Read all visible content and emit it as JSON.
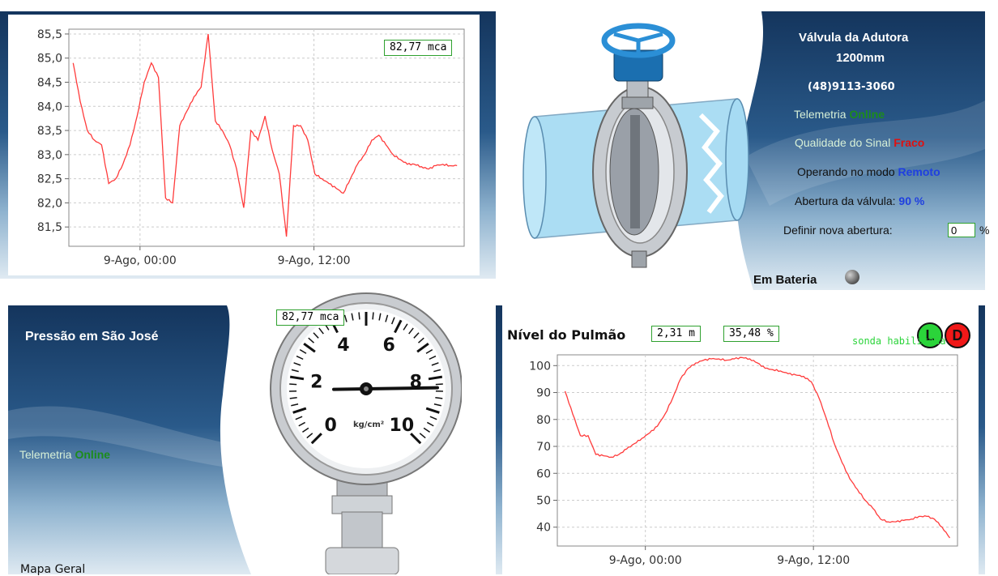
{
  "pressure_chart": {
    "value_display": "82,77 mca",
    "chart_data": {
      "type": "line",
      "y_ticks": [
        "85,5",
        "85,0",
        "84,5",
        "84,0",
        "83,5",
        "83,0",
        "82,5",
        "82,0",
        "81,5"
      ],
      "x_ticks": [
        "9-Ago, 00:00",
        "9-Ago, 12:00"
      ],
      "ylim": [
        81.1,
        85.6
      ],
      "grid": true,
      "series": [
        {
          "color": "#ff3b3b",
          "x": [
            0,
            0.5,
            1,
            1.5,
            2,
            2.5,
            3,
            3.5,
            4,
            4.5,
            5,
            5.5,
            6,
            6.5,
            7,
            7.5,
            8,
            8.5,
            9,
            9.5,
            10,
            10.5,
            11,
            11.5,
            12,
            12.5,
            13,
            13.5,
            14,
            14.5,
            15,
            15.5,
            16,
            16.5,
            17,
            17.5,
            18,
            18.5,
            19,
            19.5,
            20,
            20.5,
            21,
            21.5,
            22,
            22.5,
            23,
            23.5,
            24,
            24.5,
            25,
            25.5,
            26,
            26.5,
            27,
            27.5,
            28,
            28.5,
            29,
            29.5,
            30,
            30.5,
            31,
            31.5,
            32,
            32.5,
            33,
            33.5,
            34,
            34.5,
            35,
            35.5,
            36,
            36.5,
            37,
            37.5,
            38,
            38.5,
            39,
            39.5,
            40,
            40.5,
            41,
            41.5,
            42,
            42.5,
            43
          ],
          "y": [
            84.9,
            84.1,
            83.5,
            83.3,
            83.2,
            82.4,
            82.5,
            82.8,
            83.2,
            83.8,
            84.5,
            84.9,
            84.6,
            82.1,
            82.0,
            83.6,
            83.9,
            84.2,
            84.4,
            85.5,
            83.7,
            83.5,
            83.2,
            82.7,
            81.9,
            83.5,
            83.3,
            83.8,
            83.1,
            82.6,
            81.3,
            83.6,
            83.6,
            83.3,
            82.6,
            82.5,
            82.4,
            82.3,
            82.2,
            82.5,
            82.8,
            83.0,
            83.3,
            83.4,
            83.2,
            83.0,
            82.9,
            82.8,
            82.8,
            82.75,
            82.7,
            82.77,
            82.8,
            82.77,
            82.77,
            82.77,
            82.77,
            82.77,
            82.77,
            82.77,
            82.77,
            82.77,
            82.77,
            82.77,
            82.77,
            82.77,
            82.77,
            82.77,
            82.77,
            82.77,
            82.77,
            82.77,
            82.77,
            82.77,
            82.77,
            82.77,
            82.77,
            82.77,
            82.77,
            82.77,
            82.77,
            82.77,
            82.77,
            82.77,
            82.77,
            82.77,
            82.77
          ]
        }
      ]
    }
  },
  "valve_panel": {
    "title_line1": "Válvula da Adutora",
    "title_line2": "1200mm",
    "phone": "(48)9113-3060",
    "telemetry_label": "Telemetria",
    "telemetry_value": "Online",
    "signal_label": "Qualidade do Sinal",
    "signal_value": "Fraco",
    "mode_label": "Operando no modo",
    "mode_value": "Remoto",
    "opening_label": "Abertura da válvula:",
    "opening_value": "90 %",
    "new_opening_label": "Definir nova abertura:",
    "new_opening_value": "0",
    "new_opening_unit": "%",
    "battery_label": "Em Bateria",
    "colors": {
      "online": "#1c8c1c",
      "weak": "#e01010",
      "remote": "#1f3fe0"
    }
  },
  "sao_jose_panel": {
    "title": "Pressão em São José",
    "telemetry_label": "Telemetria",
    "telemetry_value": "Online",
    "gauge_value_display": "82,77 mca",
    "gauge_numbers": [
      "0",
      "2",
      "4",
      "6",
      "8",
      "10"
    ],
    "gauge_unit": "kg/cm²",
    "gauge_level": 8.3,
    "map_link": "Mapa Geral"
  },
  "lung_panel": {
    "title": "Nível do Pulmão",
    "level_m": "2,31 m",
    "level_pct": "35,48 %",
    "btn_l": "L",
    "btn_d": "D",
    "probe_status": "sonda habilitada",
    "chart_data": {
      "type": "line",
      "y_ticks": [
        "100",
        "90",
        "80",
        "70",
        "60",
        "50",
        "40"
      ],
      "x_ticks": [
        "9-Ago, 00:00",
        "9-Ago, 12:00"
      ],
      "ylim": [
        33,
        104
      ],
      "grid": true,
      "series": [
        {
          "color": "#ff3b3b",
          "x": [
            0,
            1,
            2,
            3,
            4,
            5,
            6,
            7,
            8,
            9,
            10,
            11,
            12,
            13,
            14,
            15,
            16,
            17,
            18,
            19,
            20,
            21,
            22,
            23,
            24,
            25,
            26,
            27,
            28,
            29,
            30,
            31,
            32,
            33,
            34,
            35,
            36,
            37,
            38,
            39,
            40,
            41,
            42,
            43,
            44,
            45,
            46,
            47,
            48,
            49,
            50
          ],
          "y": [
            90.5,
            82,
            74,
            74,
            67,
            66.5,
            66,
            67,
            69,
            71,
            73,
            75,
            77.5,
            82,
            88,
            95,
            99,
            101,
            102,
            102.5,
            102.5,
            102,
            102.5,
            103,
            102.5,
            101,
            99,
            98.5,
            98,
            97,
            96.5,
            96,
            94,
            88,
            80,
            71,
            64,
            58,
            54,
            50,
            47,
            43,
            42,
            42,
            42.5,
            43,
            44,
            44,
            43,
            40,
            36
          ]
        }
      ]
    }
  }
}
